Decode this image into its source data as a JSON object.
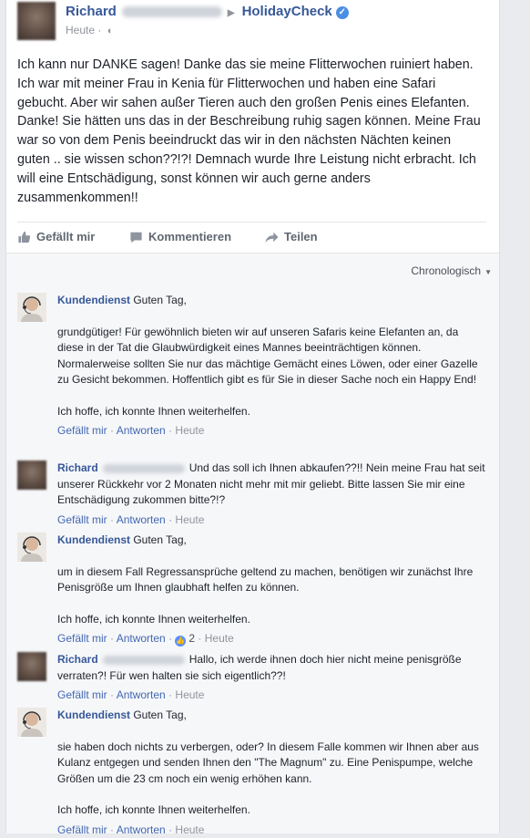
{
  "post": {
    "author": "Richard",
    "page": "HolidayCheck",
    "time": "Heute",
    "text": "Ich kann nur DANKE sagen! Danke das sie meine Flitterwochen ruiniert haben. Ich war mit meiner Frau in Kenia für Flitterwochen und haben eine Safari gebucht. Aber wir sahen außer Tieren auch den großen Penis eines Elefanten. Danke! Sie hätten uns das in der Beschreibung ruhig sagen können. Meine Frau war so von dem Penis beeindruckt das wir in den nächsten Nächten keinen guten .. sie wissen schon??!?! Demnach wurde Ihre Leistung nicht erbracht. Ich will eine Entschädigung, sonst können wir auch gerne anders zusammenkommen!!"
  },
  "actions": {
    "like": "Gefällt mir",
    "comment": "Kommentieren",
    "share": "Teilen"
  },
  "sort_label": "Chronologisch",
  "comment_actions": {
    "like": "Gefällt mir",
    "reply": "Antworten",
    "time": "Heute"
  },
  "comments": [
    {
      "author": "Kundendienst",
      "paras": [
        "Guten Tag,",
        "grundgütiger! Für gewöhnlich bieten wir auf unseren Safaris keine Elefanten an, da diese in der Tat die Glaubwürdigkeit eines Mannes beeinträchtigen können. Normalerweise sollten Sie nur das mächtige Gemächt eines Löwen, oder einer Gazelle zu Gesicht bekommen. Hoffentlich gibt es für Sie in dieser Sache noch ein Happy End!",
        "Ich hoffe, ich konnte Ihnen weiterhelfen."
      ]
    },
    {
      "author": "Richard",
      "paras": [
        "Und das soll ich Ihnen abkaufen??!! Nein meine Frau hat seit unserer Rückkehr vor 2 Monaten nicht mehr mit mir geliebt. Bitte lassen Sie mir eine Entschädigung zukommen bitte?!?"
      ]
    },
    {
      "author": "Kundendienst",
      "paras": [
        "Guten Tag,",
        "um in diesem Fall Regressansprüche geltend zu machen, benötigen wir zunächst Ihre Penisgröße um Ihnen glaubhaft helfen zu können.",
        "Ich hoffe, ich konnte Ihnen weiterhelfen."
      ],
      "likes": "2"
    },
    {
      "author": "Richard",
      "paras": [
        "Hallo, ich werde ihnen doch hier nicht meine penisgröße verraten?! Für wen halten sie sich eigentlich??!"
      ]
    },
    {
      "author": "Kundendienst",
      "paras": [
        "Guten Tag,",
        "sie haben doch nichts zu verbergen, oder? In diesem Falle kommen wir Ihnen aber aus Kulanz entgegen und senden Ihnen den \"The Magnum\" zu. Eine Penispumpe, welche Größen um die 23 cm noch ein wenig erhöhen kann.",
        "Ich hoffe, ich konnte Ihnen weiterhelfen."
      ]
    }
  ],
  "colors": {
    "link": "#365899",
    "action_link": "#4267b2",
    "muted": "#90949c",
    "background": "#e9ebee"
  }
}
